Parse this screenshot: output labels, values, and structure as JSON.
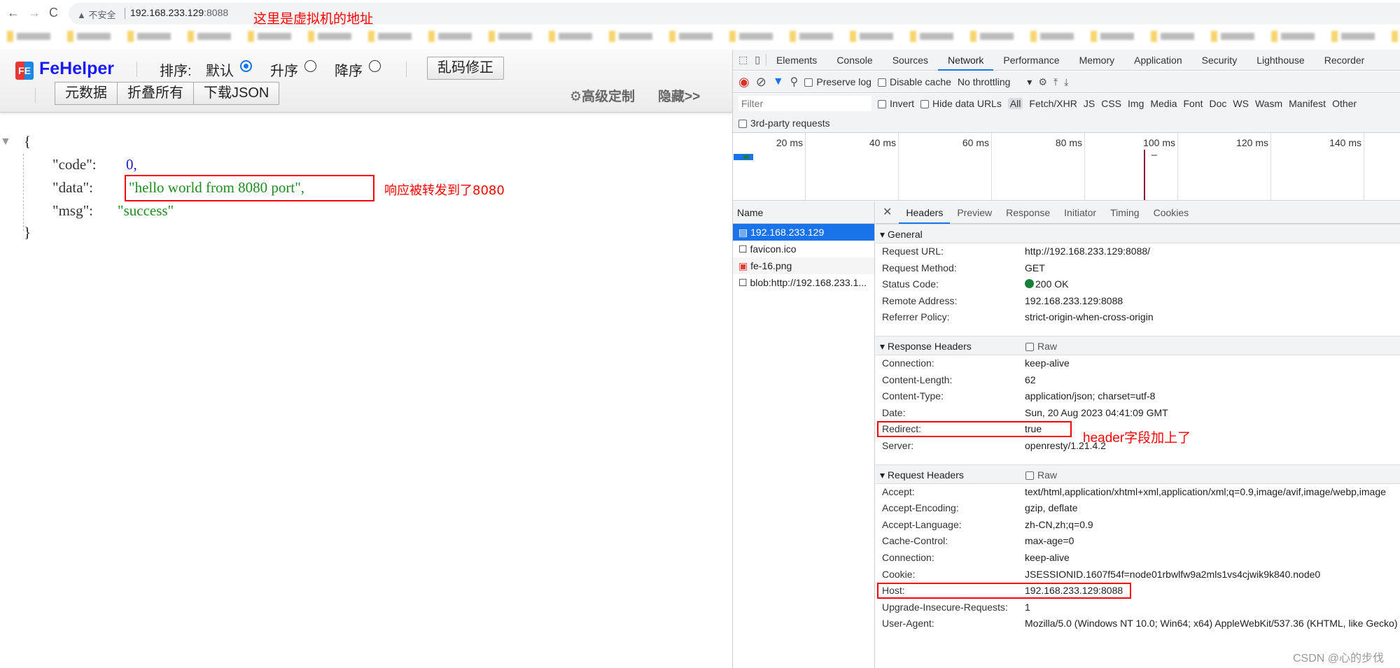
{
  "browser": {
    "back": "←",
    "forward": "→",
    "reload": "C",
    "security": "▲ 不安全",
    "url_host": "192.168.233.129",
    "url_port": ":8088"
  },
  "annotations": {
    "address_note": "这里是虚拟机的地址",
    "data_note": "响应被转发到了8080",
    "header_note": "header字段加上了",
    "watermark": "CSDN @心的步伐"
  },
  "fehelper": {
    "logo": "FE",
    "title": "FeHelper",
    "sort_label": "排序:",
    "sort_options": [
      {
        "label": "默认",
        "selected": true
      },
      {
        "label": "升序",
        "selected": false
      },
      {
        "label": "降序",
        "selected": false
      }
    ],
    "fix_encoding": "乱码修正",
    "buttons": [
      "元数据",
      "折叠所有",
      "下载JSON"
    ],
    "advanced": "⚙高级定制",
    "hide": "隐藏>>"
  },
  "json": {
    "open": "{",
    "close": "}",
    "entries": [
      {
        "key": "\"code\":",
        "value": "0,"
      },
      {
        "key": "\"data\":",
        "value": "\"hello world from 8080 port\","
      },
      {
        "key": "\"msg\":",
        "value": "\"success\""
      }
    ]
  },
  "devtools": {
    "tabs": [
      "Elements",
      "Console",
      "Sources",
      "Network",
      "Performance",
      "Memory",
      "Application",
      "Security",
      "Lighthouse",
      "Recorder"
    ],
    "active_tab": "Network",
    "toolbar": {
      "preserve_log": "Preserve log",
      "disable_cache": "Disable cache",
      "throttling": "No throttling"
    },
    "filter": {
      "placeholder": "Filter",
      "invert": "Invert",
      "hide_data_urls": "Hide data URLs",
      "types": [
        "All",
        "Fetch/XHR",
        "JS",
        "CSS",
        "Img",
        "Media",
        "Font",
        "Doc",
        "WS",
        "Wasm",
        "Manifest",
        "Other"
      ],
      "third_party": "3rd-party requests"
    },
    "timeline_ticks": [
      "20 ms",
      "40 ms",
      "60 ms",
      "80 ms",
      "100 ms",
      "120 ms",
      "140 ms"
    ],
    "name_header": "Name",
    "requests": [
      "192.168.233.129",
      "favicon.ico",
      "fe-16.png",
      "blob:http://192.168.233.1..."
    ],
    "detail_tabs": [
      "Headers",
      "Preview",
      "Response",
      "Initiator",
      "Timing",
      "Cookies"
    ],
    "general": {
      "title": "General",
      "rows": [
        [
          "Request URL:",
          "http://192.168.233.129:8088/"
        ],
        [
          "Request Method:",
          "GET"
        ],
        [
          "Status Code:",
          "200 OK"
        ],
        [
          "Remote Address:",
          "192.168.233.129:8088"
        ],
        [
          "Referrer Policy:",
          "strict-origin-when-cross-origin"
        ]
      ]
    },
    "response_headers": {
      "title": "Response Headers",
      "raw": "Raw",
      "rows": [
        [
          "Connection:",
          "keep-alive"
        ],
        [
          "Content-Length:",
          "62"
        ],
        [
          "Content-Type:",
          "application/json; charset=utf-8"
        ],
        [
          "Date:",
          "Sun, 20 Aug 2023 04:41:09 GMT"
        ],
        [
          "Redirect:",
          "true"
        ],
        [
          "Server:",
          "openresty/1.21.4.2"
        ]
      ]
    },
    "request_headers": {
      "title": "Request Headers",
      "raw": "Raw",
      "rows": [
        [
          "Accept:",
          "text/html,application/xhtml+xml,application/xml;q=0.9,image/avif,image/webp,image"
        ],
        [
          "Accept-Encoding:",
          "gzip, deflate"
        ],
        [
          "Accept-Language:",
          "zh-CN,zh;q=0.9"
        ],
        [
          "Cache-Control:",
          "max-age=0"
        ],
        [
          "Connection:",
          "keep-alive"
        ],
        [
          "Cookie:",
          "JSESSIONID.1607f54f=node01rbwlfw9a2mls1vs4cjwik9k840.node0"
        ],
        [
          "Host:",
          "192.168.233.129:8088"
        ],
        [
          "Upgrade-Insecure-Requests:",
          "1"
        ],
        [
          "User-Agent:",
          "Mozilla/5.0 (Windows NT 10.0; Win64; x64) AppleWebKit/537.36 (KHTML, like Gecko)"
        ]
      ]
    }
  }
}
